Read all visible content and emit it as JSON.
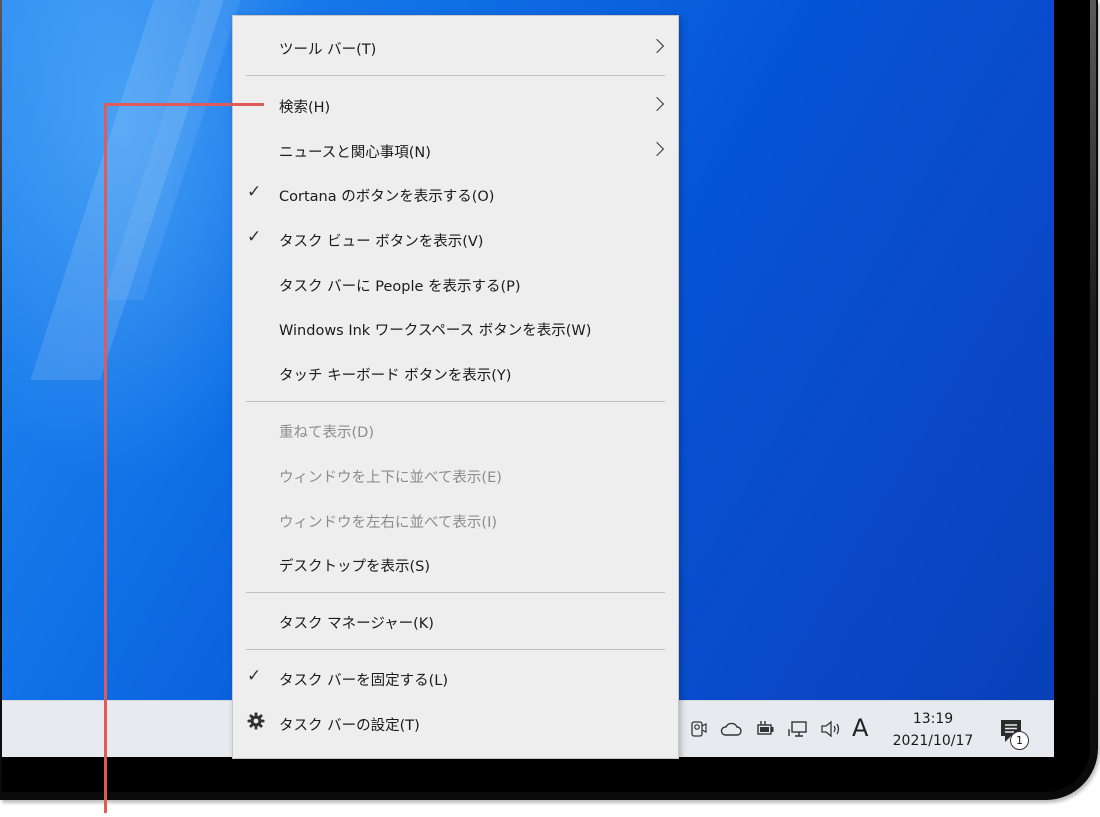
{
  "menu": {
    "items": [
      {
        "label": "ツール バー(T)",
        "submenu": true
      },
      {
        "label": "検索(H)",
        "submenu": true
      },
      {
        "label": "ニュースと関心事項(N)",
        "submenu": true
      },
      {
        "label": "Cortana のボタンを表示する(O)",
        "checked": true
      },
      {
        "label": "タスク ビュー ボタンを表示(V)",
        "checked": true
      },
      {
        "label": "タスク バーに People を表示する(P)"
      },
      {
        "label": "Windows Ink ワークスペース ボタンを表示(W)"
      },
      {
        "label": "タッチ キーボード ボタンを表示(Y)"
      },
      {
        "label": "重ねて表示(D)",
        "disabled": true
      },
      {
        "label": "ウィンドウを上下に並べて表示(E)",
        "disabled": true
      },
      {
        "label": "ウィンドウを左右に並べて表示(I)",
        "disabled": true
      },
      {
        "label": "デスクトップを表示(S)"
      },
      {
        "label": "タスク マネージャー(K)"
      },
      {
        "label": "タスク バーを固定する(L)",
        "checked": true
      },
      {
        "label": "タスク バーの設定(T)",
        "icon": "gear-icon"
      }
    ]
  },
  "taskbar": {
    "ime_indicator": "A",
    "clock_time": "13:19",
    "clock_date": "2021/10/17",
    "notification_count": "1",
    "tray_icons": [
      "meet-now-icon",
      "onedrive-cloud-icon",
      "power-icon",
      "network-icon",
      "volume-icon"
    ]
  },
  "colors": {
    "callout": "#e05a5a",
    "menu_bg": "#eeeeee",
    "taskbar_bg": "#e7ebef"
  }
}
